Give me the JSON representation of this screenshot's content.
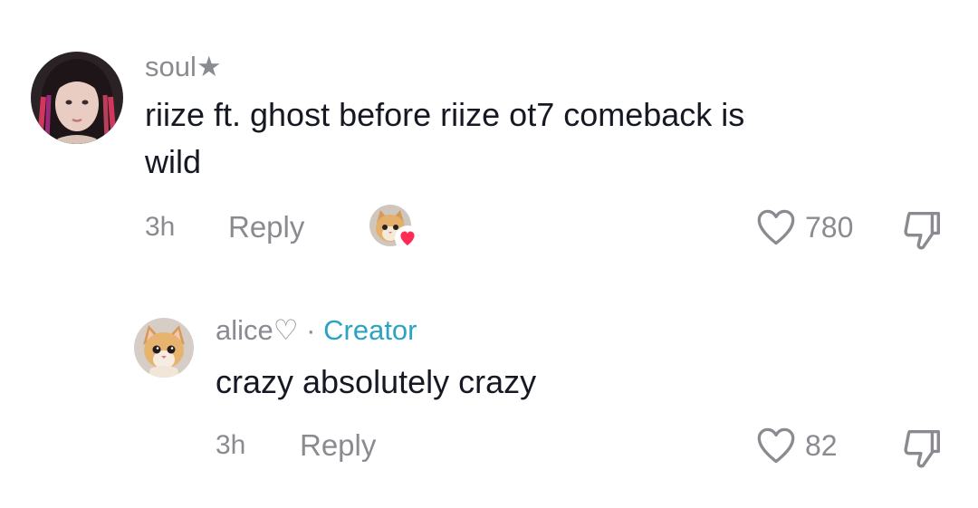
{
  "comments": [
    {
      "username": "soul★",
      "text_line1": "riize ft. ghost before riize ot7 comeback is",
      "text_line2": "wild",
      "time": "3h",
      "reply_label": "Reply",
      "likes": "780",
      "avatar_icon": "user-avatar-photo",
      "creator_liked_icon": "cat-avatar-heart-badge"
    }
  ],
  "reply": {
    "username": "alice♡",
    "separator": "·",
    "badge": "Creator",
    "text": "crazy absolutely crazy",
    "time": "3h",
    "reply_label": "Reply",
    "likes": "82",
    "avatar_icon": "cat-avatar"
  },
  "colors": {
    "muted": "#8a8b91",
    "text": "#161823",
    "creator": "#2ba3c1",
    "heart": "#fe2c55"
  }
}
